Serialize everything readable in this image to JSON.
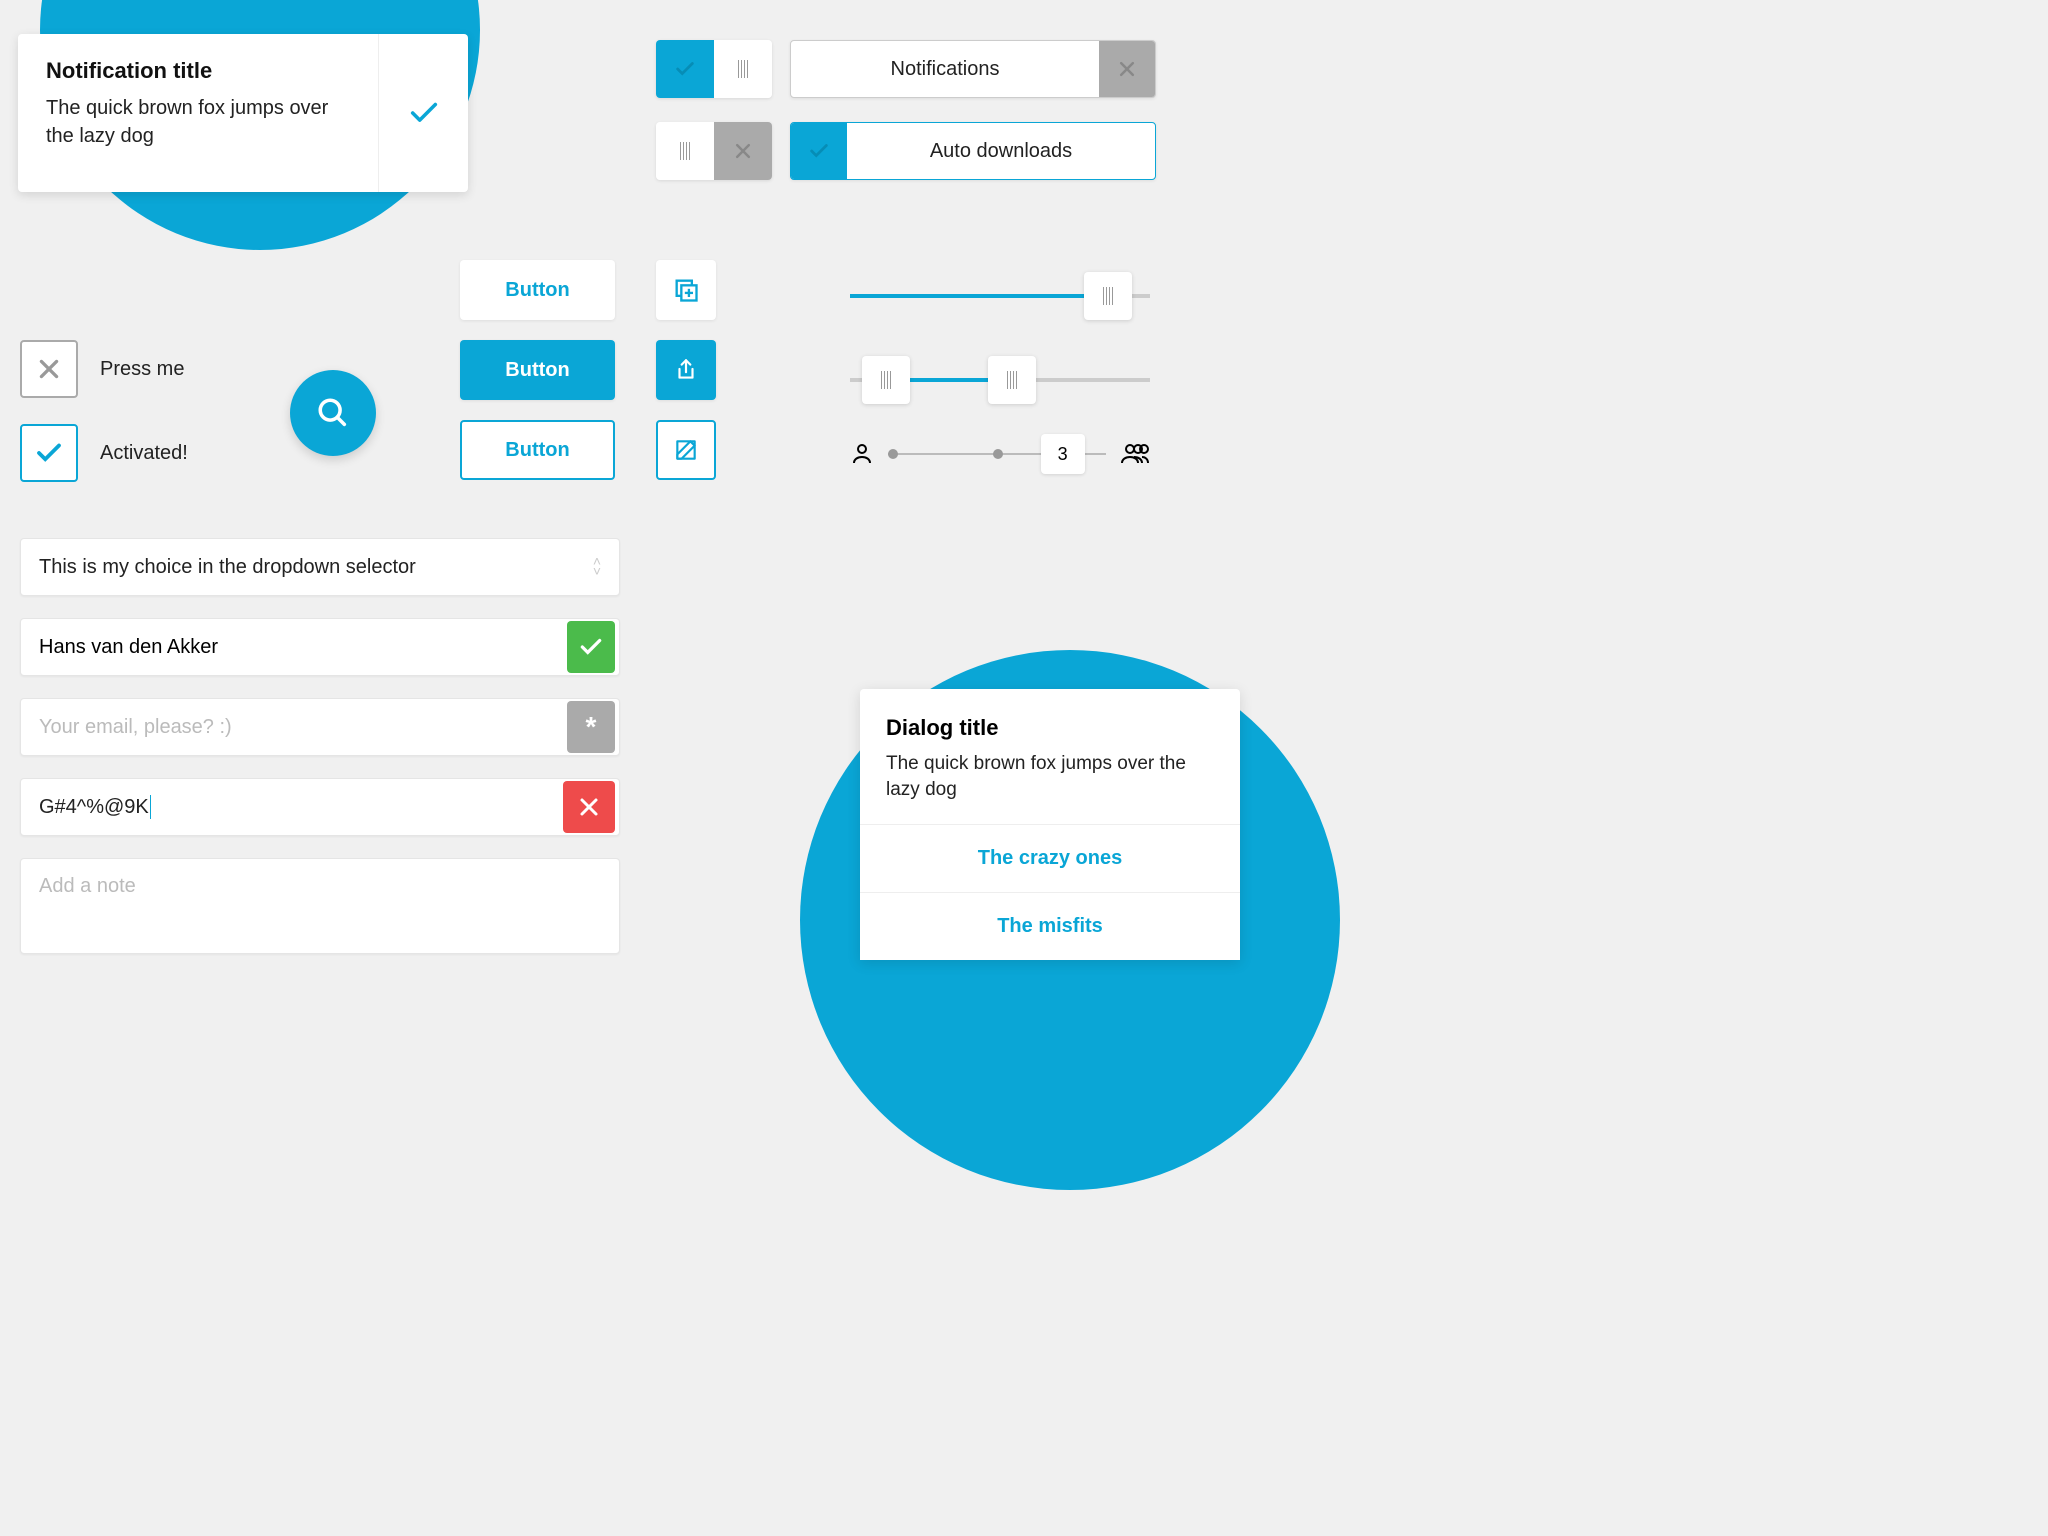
{
  "notification": {
    "title": "Notification title",
    "text": "The quick brown fox jumps over the lazy dog"
  },
  "toggles": {
    "notifications_label": "Notifications",
    "auto_dl_label": "Auto downloads"
  },
  "checkboxes": {
    "press_label": "Press me",
    "activated_label": "Activated!"
  },
  "buttons": {
    "flat": "Button",
    "fill": "Button",
    "outline": "Button"
  },
  "people_slider_value": "3",
  "form": {
    "select_value": "This is my choice in the dropdown selector",
    "name_value": "Hans van den Akker",
    "email_placeholder": "Your email, please? :)",
    "password_value": "G#4^%@9K",
    "note_placeholder": "Add a note"
  },
  "dialog": {
    "title": "Dialog title",
    "text": "The quick brown fox jumps over the lazy dog",
    "opt1": "The crazy ones",
    "opt2": "The misfits"
  },
  "annex_star": "*"
}
